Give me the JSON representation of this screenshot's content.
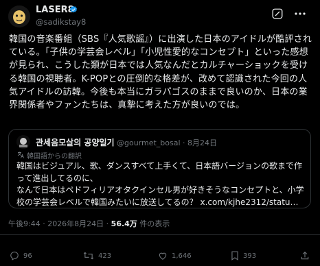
{
  "author": {
    "display_name": "LASER8",
    "handle": "@sadikstay8"
  },
  "tweet_text": "韓国の音楽番組（SBS『人気歌謡』）に出演した日本のアイドルが酷評されている。「子供の学芸会レベル」「小児性愛的なコンセプト」といった感想が見られ、こうした類が日本では人気なんだとカルチャーショックを受ける韓国の視聴者。K-POPとの圧倒的な格差が、改めて認識された今回の人気アイドルの訪韓。今後も本当にガラパゴスのままで良いのか、日本の業界関係者やファンたちは、真摯に考えた方が良いのでは。",
  "quote": {
    "display_name": "관세음모살의 공양일기",
    "meta": "@gourmet_bosal · 8月24日",
    "translated_label": "韓国語からの翻訳",
    "text_main": "韓国はビジュアル、歌、ダンスすべて上手くて、日本語バージョンの歌まで作って進出してるのに、\nなんで日本はペドフィリアオタクインセル男が好きそうなコンセプトと、小学校の学芸会レベルで韓国みたいに放送してるの？ ",
    "link": "x.com/kjhe2312/statu…"
  },
  "meta": {
    "time_date": "午後9:44 · 2026年8月24日 · ",
    "views": "56.4万",
    "views_label": " 件の表示"
  },
  "actions": {
    "replies": "96",
    "reposts": "423",
    "likes": "1,646",
    "bookmarks": "393"
  },
  "colors": {
    "background": "#000000",
    "text": "#e7e9ea",
    "muted": "#71767b",
    "border": "#2f3336",
    "verified": "#1d9bf0"
  }
}
